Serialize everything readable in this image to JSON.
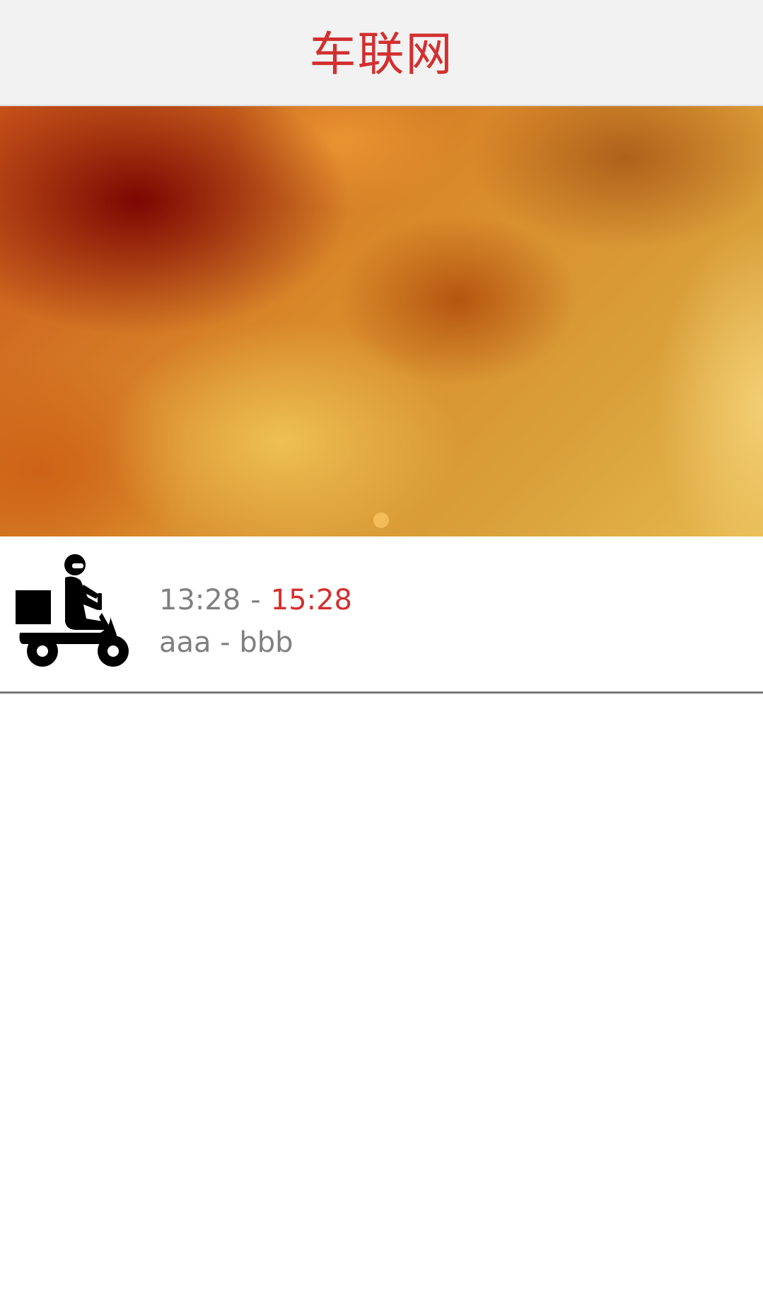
{
  "header": {
    "title": "车联网",
    "title_color": "#d32f2f"
  },
  "banner": {
    "page_count": 1,
    "active_index": 0
  },
  "trips": [
    {
      "icon": "delivery-scooter-icon",
      "start_time": "13:28",
      "separator": "-",
      "end_time": "15:28",
      "end_time_color": "#d32f2f",
      "route": "aaa - bbb"
    }
  ]
}
